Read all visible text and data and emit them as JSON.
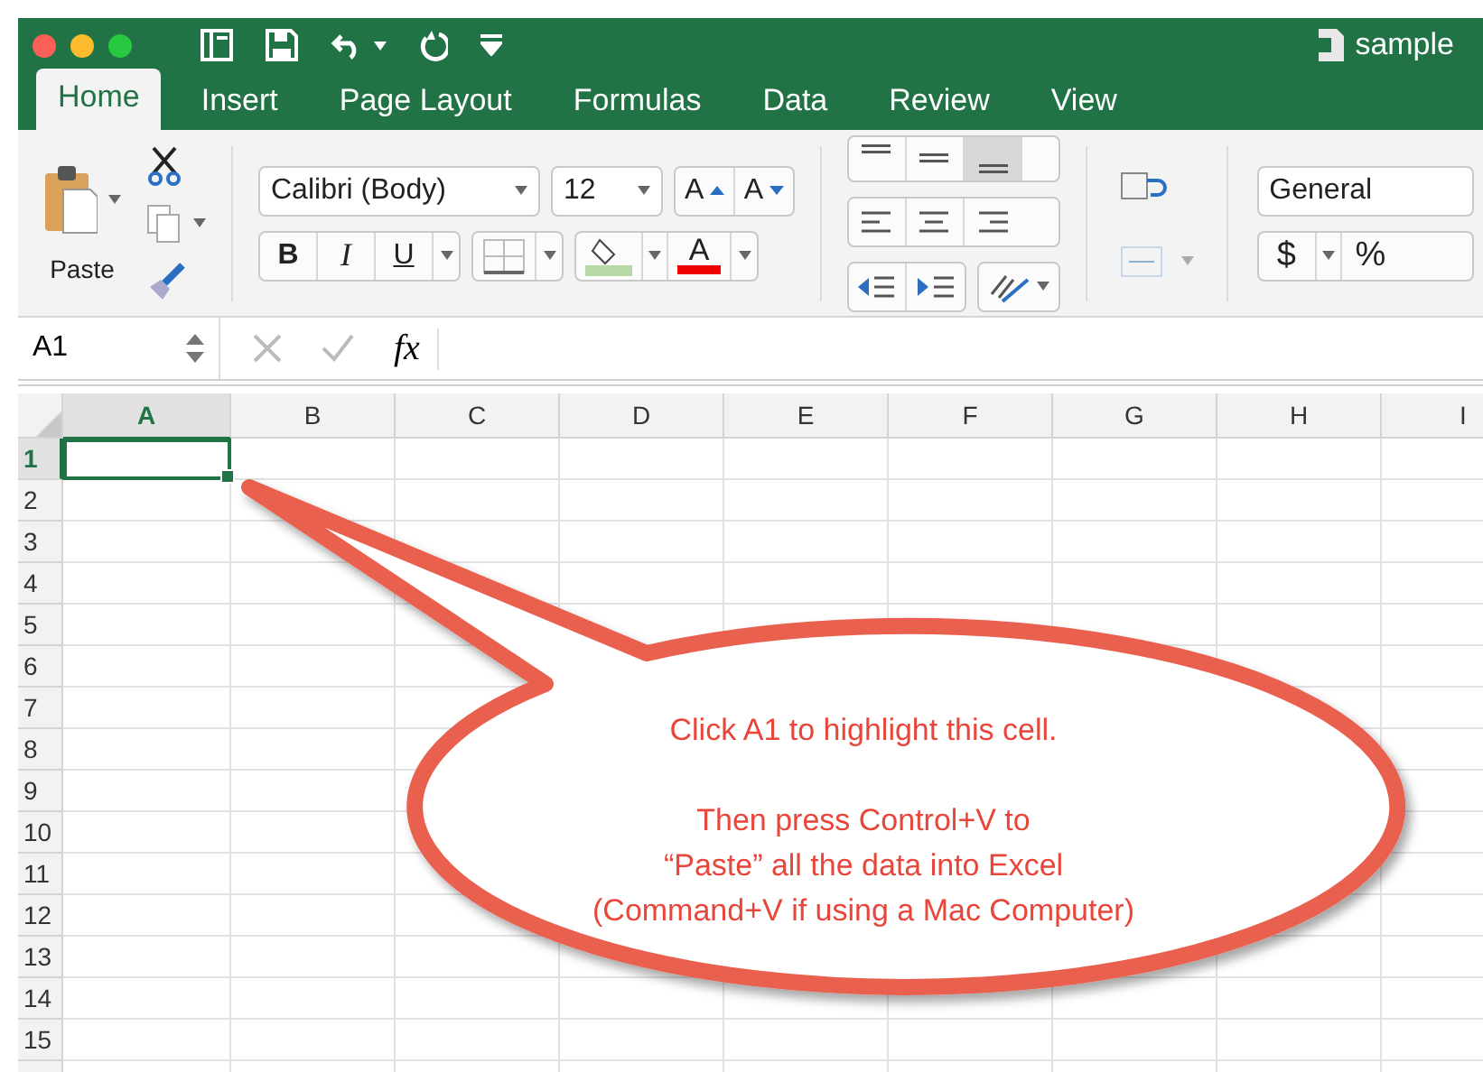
{
  "window": {
    "title": "sample"
  },
  "tabs": [
    {
      "label": "Home",
      "selected": true
    },
    {
      "label": "Insert",
      "selected": false
    },
    {
      "label": "Page Layout",
      "selected": false
    },
    {
      "label": "Formulas",
      "selected": false
    },
    {
      "label": "Data",
      "selected": false
    },
    {
      "label": "Review",
      "selected": false
    },
    {
      "label": "View",
      "selected": false
    }
  ],
  "ribbon": {
    "paste_label": "Paste",
    "font_name": "Calibri (Body)",
    "font_size": "12",
    "grow_font": "A",
    "shrink_font": "A",
    "bold": "B",
    "italic": "I",
    "underline": "U",
    "font_color": "A",
    "vertical_align": [
      {
        "selected": false
      },
      {
        "selected": false
      },
      {
        "selected": true
      }
    ],
    "number_format": "General",
    "currency": "$",
    "percent": "%"
  },
  "formula_bar": {
    "name_box": "A1",
    "function_label": "fx"
  },
  "sheet": {
    "columns": [
      {
        "label": "A",
        "selected": true
      },
      {
        "label": "B",
        "selected": false
      },
      {
        "label": "C",
        "selected": false
      },
      {
        "label": "D",
        "selected": false
      },
      {
        "label": "E",
        "selected": false
      },
      {
        "label": "F",
        "selected": false
      },
      {
        "label": "G",
        "selected": false
      },
      {
        "label": "H",
        "selected": false
      },
      {
        "label": "I",
        "selected": false
      }
    ],
    "rows": [
      {
        "label": "1",
        "selected": true
      },
      {
        "label": "2",
        "selected": false
      },
      {
        "label": "3",
        "selected": false
      },
      {
        "label": "4",
        "selected": false
      },
      {
        "label": "5",
        "selected": false
      },
      {
        "label": "6",
        "selected": false
      },
      {
        "label": "7",
        "selected": false
      },
      {
        "label": "8",
        "selected": false
      },
      {
        "label": "9",
        "selected": false
      },
      {
        "label": "10",
        "selected": false
      },
      {
        "label": "11",
        "selected": false
      },
      {
        "label": "12",
        "selected": false
      },
      {
        "label": "13",
        "selected": false
      },
      {
        "label": "14",
        "selected": false
      },
      {
        "label": "15",
        "selected": false
      }
    ]
  },
  "callout": {
    "lines": [
      "Click A1 to highlight this cell.",
      "Then press Control+V to",
      "“Paste” all the data into Excel",
      "(Command+V if using a Mac Computer)"
    ]
  }
}
